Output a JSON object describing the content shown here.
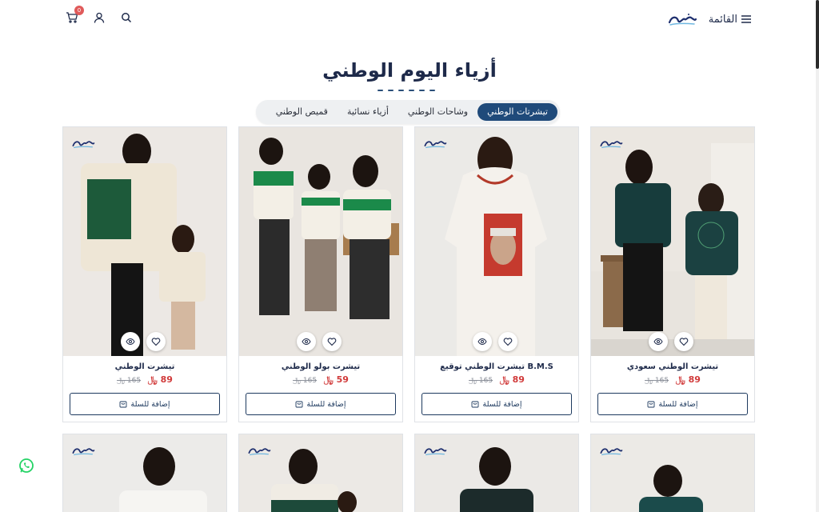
{
  "header": {
    "menu_label": "القائمة",
    "cart_count": "0",
    "logo_name": "brand-logo"
  },
  "page_title": "أزياء اليوم الوطني",
  "tabs": [
    {
      "label": "تيشرتات الوطني",
      "active": true
    },
    {
      "label": "وشاحات الوطني",
      "active": false
    },
    {
      "label": "أزياء نسائية",
      "active": false
    },
    {
      "label": "قميص الوطني",
      "active": false
    }
  ],
  "currency_symbol": "﷼",
  "products": [
    {
      "name": "تيشرت الوطني سعودي",
      "price": "89",
      "old_price": "165",
      "add_label": "إضافة للسلة"
    },
    {
      "name": "تيشرت الوطني توقيع B.M.S",
      "price": "89",
      "old_price": "165",
      "add_label": "إضافة للسلة"
    },
    {
      "name": "تيشرت بولو الوطني",
      "price": "59",
      "old_price": "165",
      "add_label": "إضافة للسلة"
    },
    {
      "name": "تيشرت الوطني",
      "price": "89",
      "old_price": "165",
      "add_label": "إضافة للسلة"
    }
  ],
  "colors": {
    "primary": "#1f4a7a",
    "price": "#d13a3a",
    "title": "#1e2a4a",
    "whatsapp": "#25d366"
  },
  "icons": [
    "cart-icon",
    "user-icon",
    "search-icon",
    "hamburger-icon",
    "heart-icon",
    "eye-icon",
    "bag-icon",
    "whatsapp-icon"
  ]
}
